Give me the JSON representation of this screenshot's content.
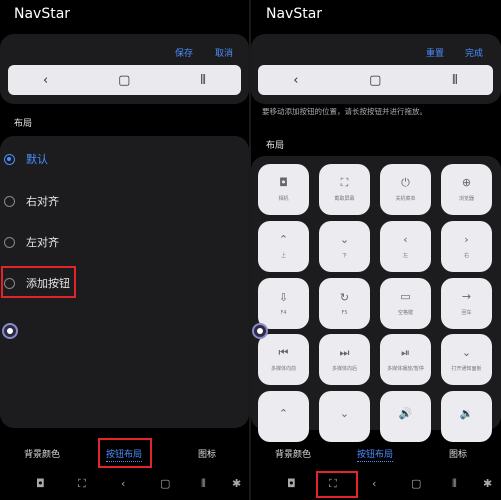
{
  "left": {
    "app_title": "NavStar",
    "save_label": "保存",
    "cancel_label": "取消",
    "nav_preview": {
      "back": "‹",
      "home": "▢",
      "recents": "⦀"
    },
    "section_title": "布局",
    "options": [
      {
        "label": "默认",
        "selected": true
      },
      {
        "label": "右对齐",
        "selected": false
      },
      {
        "label": "左对齐",
        "selected": false
      },
      {
        "label": "添加按钮",
        "selected": false
      }
    ]
  },
  "right": {
    "app_title": "NavStar",
    "reset_label": "重置",
    "done_label": "完成",
    "nav_preview": {
      "back": "‹",
      "home": "▢",
      "recents": "⦀"
    },
    "hint": "要移动添加按钮的位置，请长按按钮并进行拖放。",
    "section_title": "布局",
    "buttons": [
      {
        "icon": "camera-icon",
        "glyph": "◘",
        "label": "相机"
      },
      {
        "icon": "screenshot-icon",
        "glyph": "⛶",
        "label": "截取屏幕"
      },
      {
        "icon": "power-icon",
        "glyph": "⏻",
        "label": "关机菜单"
      },
      {
        "icon": "globe-icon",
        "glyph": "⊕",
        "label": "浏览器"
      },
      {
        "icon": "up-icon",
        "glyph": "⌃",
        "label": "上"
      },
      {
        "icon": "down-icon",
        "glyph": "⌄",
        "label": "下"
      },
      {
        "icon": "left-icon",
        "glyph": "‹",
        "label": "左"
      },
      {
        "icon": "right-icon",
        "glyph": "›",
        "label": "右"
      },
      {
        "icon": "f4-icon",
        "glyph": "⇩",
        "label": "F4"
      },
      {
        "icon": "f5-icon",
        "glyph": "↻",
        "label": "F5"
      },
      {
        "icon": "space-icon",
        "glyph": "▭",
        "label": "空格键"
      },
      {
        "icon": "enter-icon",
        "glyph": "→",
        "label": "回车"
      },
      {
        "icon": "previous-icon",
        "glyph": "⏮",
        "label": "多媒体向前"
      },
      {
        "icon": "next-icon",
        "glyph": "⏭",
        "label": "多媒体向后"
      },
      {
        "icon": "play-pause-icon",
        "glyph": "⏯",
        "label": "多媒体播放/暂停"
      },
      {
        "icon": "notification-icon",
        "glyph": "⌄",
        "label": "打开通知面板"
      },
      {
        "icon": "chevron-up-icon",
        "glyph": "⌃",
        "label": ""
      },
      {
        "icon": "chevron-down-icon",
        "glyph": "⌄",
        "label": ""
      },
      {
        "icon": "volume-up-icon",
        "glyph": "🔊",
        "label": ""
      },
      {
        "icon": "volume-down-icon",
        "glyph": "🔉",
        "label": ""
      }
    ]
  },
  "tabs": [
    "背景颜色",
    "按钮布局",
    "图标"
  ],
  "active_tab": "按钮布局",
  "colors": {
    "accent": "#4c8dff",
    "highlight": "#e0262a",
    "card": "#1c1c1e"
  }
}
